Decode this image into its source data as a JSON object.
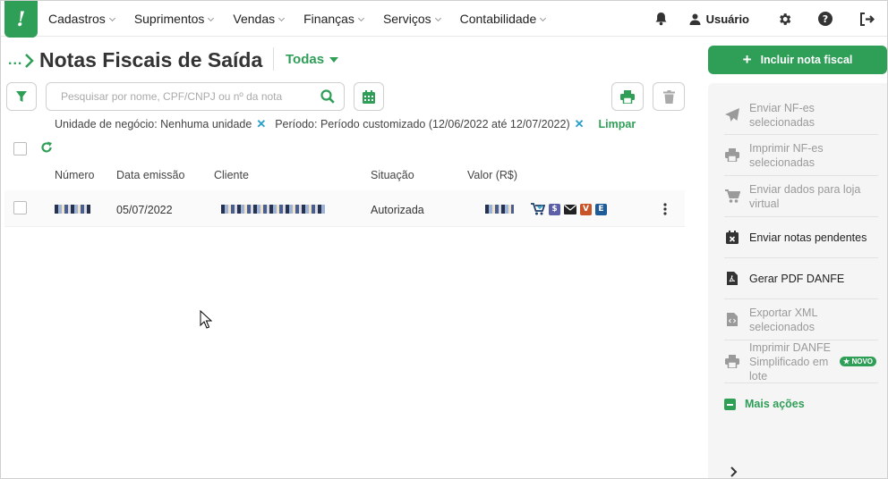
{
  "nav": {
    "logo": "!",
    "items": [
      "Cadastros",
      "Suprimentos",
      "Vendas",
      "Finanças",
      "Serviços",
      "Contabilidade"
    ],
    "user_label": "Usuário"
  },
  "header": {
    "breadcrumb_dots": "...",
    "title": "Notas Fiscais de Saída",
    "filter_select": "Todas"
  },
  "search": {
    "placeholder": "Pesquisar por nome, CPF/CNPJ ou nº da nota",
    "value": ""
  },
  "filters": {
    "business_unit": "Unidade de negócio: Nenhuma unidade",
    "period": "Período: Período customizado (12/06/2022 até 12/07/2022)",
    "clear_label": "Limpar"
  },
  "table": {
    "columns": [
      "Número",
      "Data emissão",
      "Cliente",
      "Situação",
      "Valor (R$)"
    ],
    "rows": [
      {
        "date": "05/07/2022",
        "status": "Autorizada"
      }
    ]
  },
  "row_badges": {
    "dollar": "$",
    "v": "V",
    "e": "E"
  },
  "side": {
    "include_label": "Incluir nota fiscal",
    "actions": [
      {
        "label": "Enviar NF-es selecionadas",
        "enabled": false,
        "icon": "send-icon"
      },
      {
        "label": "Imprimir NF-es selecionadas",
        "enabled": false,
        "icon": "printer-icon"
      },
      {
        "label": "Enviar dados para loja virtual",
        "enabled": false,
        "icon": "cart-icon"
      },
      {
        "label": "Enviar notas pendentes",
        "enabled": true,
        "icon": "calendar-x-icon"
      },
      {
        "label": "Gerar PDF DANFE",
        "enabled": true,
        "icon": "pdf-icon"
      },
      {
        "label": "Exportar XML selecionados",
        "enabled": false,
        "icon": "xml-file-icon"
      },
      {
        "label": "Imprimir DANFE Simplificado em lote",
        "enabled": false,
        "icon": "printer-icon"
      }
    ],
    "new_badge": "NOVO",
    "more_label": "Mais ações"
  },
  "colors": {
    "brand": "#2f9e57",
    "accent_blue": "#2a9fc9"
  }
}
